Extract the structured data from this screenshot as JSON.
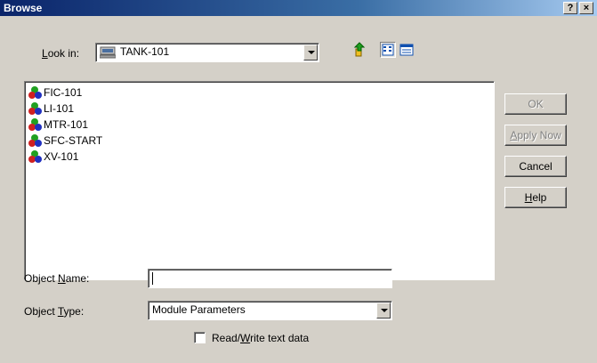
{
  "window": {
    "title": "Browse",
    "help_btn": "?",
    "close_btn": "×"
  },
  "lookin": {
    "label_prefix": "L",
    "label_rest": "ook in:",
    "value": "TANK-101"
  },
  "toolbar": {
    "icons": [
      "up-folder-icon",
      "list-view-icon",
      "details-view-icon"
    ]
  },
  "list": {
    "items": [
      {
        "label": "FIC-101",
        "icon": "module-icon"
      },
      {
        "label": "LI-101",
        "icon": "module-icon"
      },
      {
        "label": "MTR-101",
        "icon": "module-icon"
      },
      {
        "label": "SFC-START",
        "icon": "module-icon"
      },
      {
        "label": "XV-101",
        "icon": "module-icon"
      }
    ]
  },
  "buttons": {
    "ok": "OK",
    "apply_prefix": "A",
    "apply_rest": "pply Now",
    "cancel": "Cancel",
    "help_prefix": "H",
    "help_rest": "elp"
  },
  "object_name": {
    "label_a": "Object ",
    "label_u": "N",
    "label_b": "ame:",
    "value": ""
  },
  "object_type": {
    "label_a": "Object ",
    "label_u": "T",
    "label_b": "ype:",
    "value": "Module Parameters"
  },
  "rw_checkbox": {
    "label_a": "Read/",
    "label_u": "W",
    "label_b": "rite text data",
    "checked": false
  },
  "colors": {
    "titlebar_start": "#0a246a",
    "titlebar_end": "#a6caf0",
    "dialog_bg": "#d4d0c8"
  }
}
